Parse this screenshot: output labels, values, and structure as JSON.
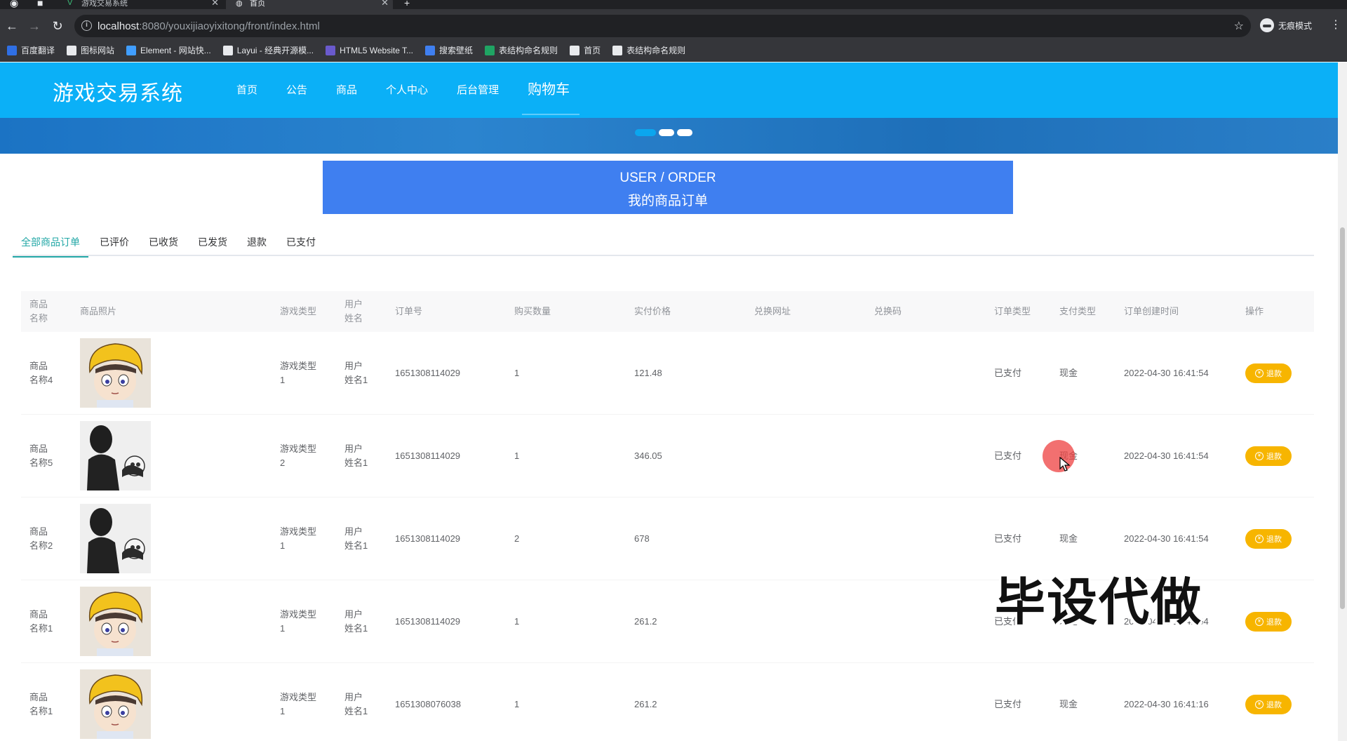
{
  "browser": {
    "tabs": [
      {
        "title": "游戏交易系统",
        "active": false
      },
      {
        "title": "首页",
        "active": true
      }
    ],
    "url": {
      "host": "localhost",
      "rest": ":8080/youxijiaoyixitong/front/index.html"
    },
    "incognito_label": "无痕模式",
    "bookmarks": [
      {
        "label": "百度翻译",
        "icon": "translate-icon",
        "color": "#2f6fe4"
      },
      {
        "label": "图标网站",
        "icon": "flag-icon",
        "color": "#e8eaed"
      },
      {
        "label": "Element - 网站快...",
        "icon": "element-icon",
        "color": "#409eff"
      },
      {
        "label": "Layui - 经典开源模...",
        "icon": "layui-icon",
        "color": "#e8eaed"
      },
      {
        "label": "HTML5 Website T...",
        "icon": "html5-icon",
        "color": "#6a5acd"
      },
      {
        "label": "搜索壁纸",
        "icon": "wallpaper-icon",
        "color": "#3f7ff0"
      },
      {
        "label": "表结构命名规则",
        "icon": "sheet-icon",
        "color": "#1fa463"
      },
      {
        "label": "首页",
        "icon": "globe-icon",
        "color": "#e8eaed"
      },
      {
        "label": "表结构命名规则",
        "icon": "globe-icon",
        "color": "#e8eaed"
      }
    ]
  },
  "site": {
    "brand": "游戏交易系统",
    "nav": [
      {
        "label": "首页",
        "active": false
      },
      {
        "label": "公告",
        "active": false
      },
      {
        "label": "商品",
        "active": false
      },
      {
        "label": "个人中心",
        "active": false
      },
      {
        "label": "后台管理",
        "active": false
      },
      {
        "label": "购物车",
        "active": true
      }
    ],
    "header_color": "#0bb0f7"
  },
  "page": {
    "title_en": "USER / ORDER",
    "title_zh": "我的商品订单",
    "tabs": [
      {
        "label": "全部商品订单",
        "active": true
      },
      {
        "label": "已评价",
        "active": false
      },
      {
        "label": "已收货",
        "active": false
      },
      {
        "label": "已发货",
        "active": false
      },
      {
        "label": "退款",
        "active": false
      },
      {
        "label": "已支付",
        "active": false
      }
    ],
    "accent_color": "#22a7a6"
  },
  "table": {
    "headers": {
      "name": "商品\n名称",
      "photo": "商品照片",
      "game_type": "游戏类型",
      "user": "用户\n姓名",
      "order_no": "订单号",
      "qty": "购买数量",
      "price": "实付价格",
      "url": "兑换网址",
      "code": "兑换码",
      "order_type": "订单类型",
      "pay_type": "支付类型",
      "created": "订单创建时间",
      "action": "操作"
    },
    "rows": [
      {
        "name": "商品\n名称4",
        "photo": "boy",
        "game_type": "游戏类型\n1",
        "user": "用户\n姓名1",
        "order_no": "1651308114029",
        "qty": "1",
        "price": "121.48",
        "url": "",
        "code": "",
        "order_type": "已支付",
        "pay_type": "现金",
        "created": "2022-04-30 16:41:54",
        "action": "退款"
      },
      {
        "name": "商品\n名称5",
        "photo": "shadow",
        "game_type": "游戏类型\n2",
        "user": "用户\n姓名1",
        "order_no": "1651308114029",
        "qty": "1",
        "price": "346.05",
        "url": "",
        "code": "",
        "order_type": "已支付",
        "pay_type": "现金",
        "created": "2022-04-30 16:41:54",
        "action": "退款"
      },
      {
        "name": "商品\n名称2",
        "photo": "shadow",
        "game_type": "游戏类型\n1",
        "user": "用户\n姓名1",
        "order_no": "1651308114029",
        "qty": "2",
        "price": "678",
        "url": "",
        "code": "",
        "order_type": "已支付",
        "pay_type": "现金",
        "created": "2022-04-30 16:41:54",
        "action": "退款"
      },
      {
        "name": "商品\n名称1",
        "photo": "boy",
        "game_type": "游戏类型\n1",
        "user": "用户\n姓名1",
        "order_no": "1651308114029",
        "qty": "1",
        "price": "261.2",
        "url": "",
        "code": "",
        "order_type": "已支付",
        "pay_type": "现金",
        "created": "2022-04-30 16:41:54",
        "action": "退款"
      },
      {
        "name": "商品\n名称1",
        "photo": "boy",
        "game_type": "游戏类型\n1",
        "user": "用户\n姓名1",
        "order_no": "1651308076038",
        "qty": "1",
        "price": "261.2",
        "url": "",
        "code": "",
        "order_type": "已支付",
        "pay_type": "现金",
        "created": "2022-04-30 16:41:16",
        "action": "退款"
      }
    ],
    "action_color": "#f7b500"
  },
  "overlay": {
    "watermark": "毕设代做"
  }
}
